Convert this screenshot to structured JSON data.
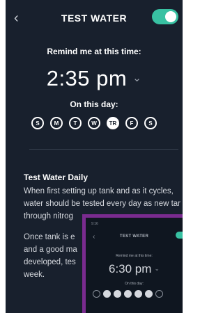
{
  "header": {
    "back_icon": "chevron-left-icon",
    "title": "TEST WATER",
    "toggle_on": true
  },
  "reminder": {
    "label": "Remind me at this time:",
    "time": "2:35 pm",
    "time_icon": "chevron-down-icon"
  },
  "days": {
    "label": "On this day:",
    "items": [
      {
        "letter": "S",
        "selected": false
      },
      {
        "letter": "M",
        "selected": false
      },
      {
        "letter": "T",
        "selected": false
      },
      {
        "letter": "W",
        "selected": false
      },
      {
        "letter": "TR",
        "selected": true
      },
      {
        "letter": "F",
        "selected": false
      },
      {
        "letter": "S",
        "selected": false
      }
    ]
  },
  "description": {
    "title": "Test Water Daily",
    "para1": "When first setting up tank and as it cycles, water should be tested every day as new tar",
    "para1_line4": "through nitrog",
    "para2_line1": "Once tank is e",
    "para2_line2": "and a good ma",
    "para2_line3": "developed, tes",
    "para2_line4": "week."
  },
  "overlay": {
    "status": "9:16",
    "title": "TEST WATER",
    "remind_label": "Remind me at this time:",
    "time": "6:30 pm",
    "day_label": "On this day:"
  },
  "colors": {
    "background": "#18202d",
    "accent": "#38c1a2",
    "overlay_border": "#7a2b8f"
  }
}
